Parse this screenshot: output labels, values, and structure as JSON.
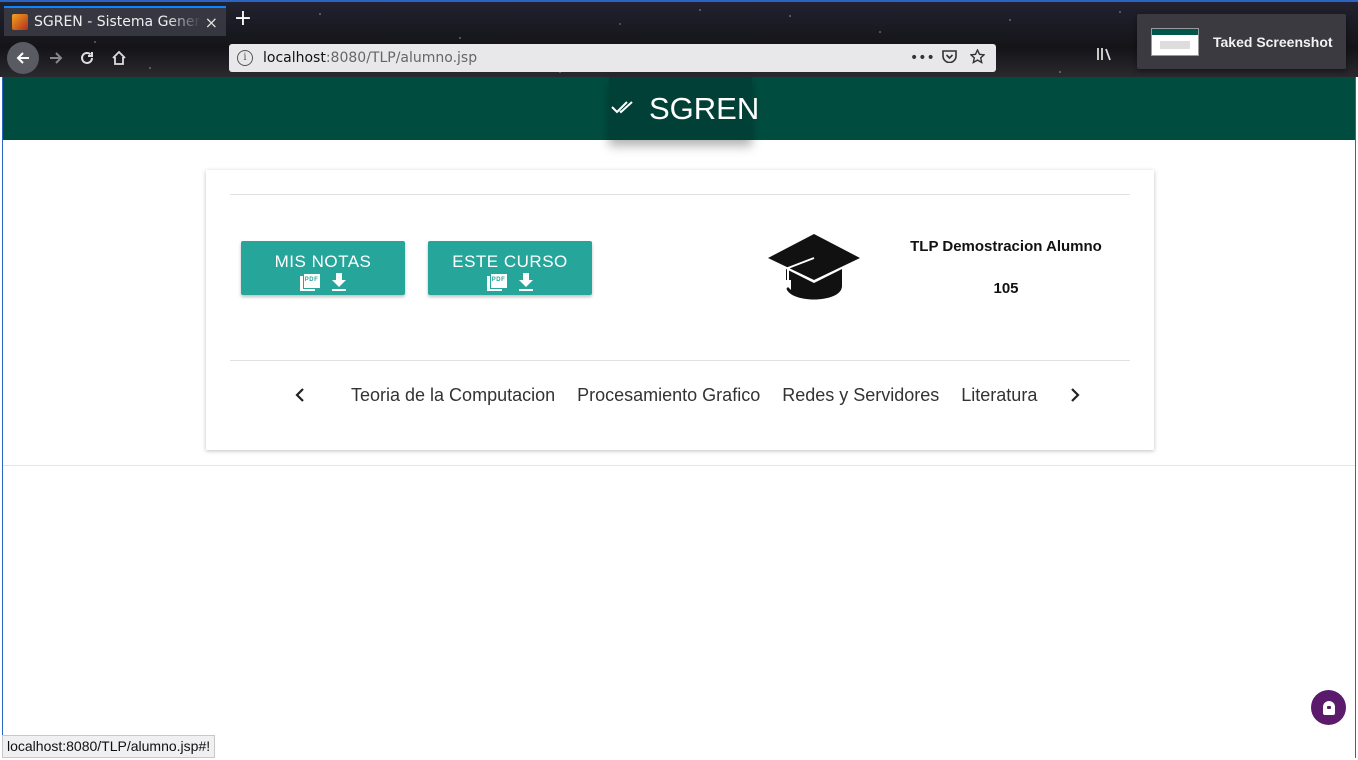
{
  "browser": {
    "tab_title": "SGREN - Sistema Generador",
    "close_glyph": "×",
    "new_tab_glyph": "+",
    "url_host": "localhost",
    "url_path": ":8080/TLP/alumno.jsp",
    "page_actions_glyph": "•••",
    "status_url": "localhost:8080/TLP/alumno.jsp#!"
  },
  "toast": {
    "text": "Taked Screenshot"
  },
  "app": {
    "brand": "SGREN",
    "buttons": {
      "grades": "MIS NOTAS",
      "course": "ESTE CURSO"
    },
    "student": {
      "name": "TLP Demostracion Alumno",
      "id": "105"
    },
    "courses": [
      "Teoria de la Computacion",
      "Procesamiento Grafico",
      "Redes y Servidores",
      "Literatura"
    ]
  },
  "colors": {
    "appbar": "#004d40",
    "brand_bg": "#004036",
    "button": "#26a69a",
    "fab": "#5b1a6c"
  }
}
